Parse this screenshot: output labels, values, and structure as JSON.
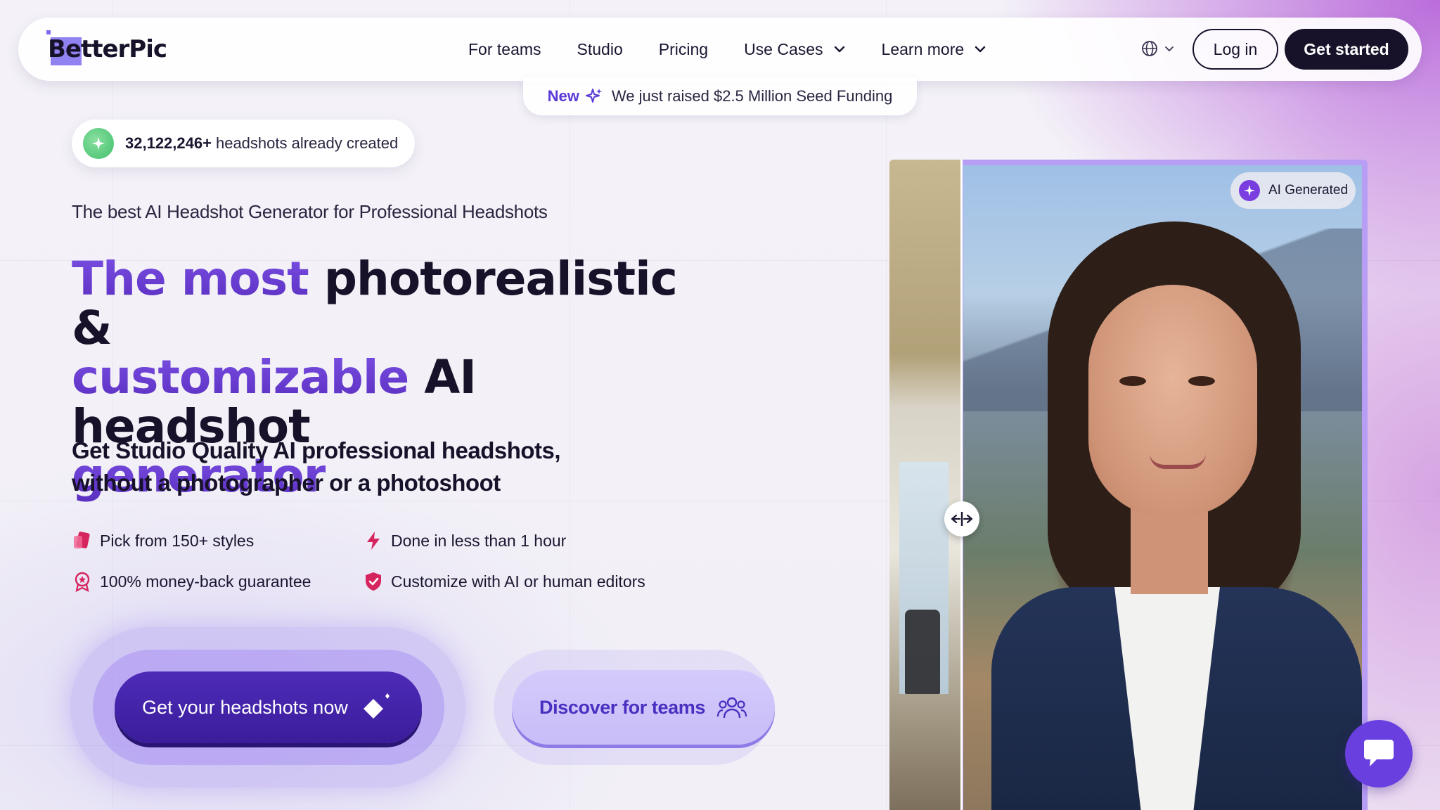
{
  "nav": {
    "logo_text": "BetterPic",
    "links": [
      "For teams",
      "Studio",
      "Pricing",
      "Use Cases",
      "Learn more"
    ],
    "login_label": "Log in",
    "get_started_label": "Get started",
    "language_icon": "globe-icon"
  },
  "announcement": {
    "tag": "New",
    "message": "We just raised $2.5 Million Seed Funding"
  },
  "counter": {
    "count": "32,122,246+",
    "text": "headshots already created"
  },
  "hero": {
    "subtitle": "The best AI Headshot Generator for Professional Headshots",
    "headline_accent": "The most",
    "headline_rest_1": "photorealistic &",
    "headline_accent_2": "customizable",
    "headline_rest_2": "AI headshot",
    "headline_accent_3": "generator",
    "lead_line_1": "Get Studio Quality AI professional headshots,",
    "lead_line_2": "without a photographer or a photoshoot"
  },
  "features": [
    {
      "icon": "styles-icon",
      "label": "Pick from 150+ styles"
    },
    {
      "icon": "lightning-icon",
      "label": "Done in less than 1 hour"
    },
    {
      "icon": "award-icon",
      "label": "100% money-back guarantee"
    },
    {
      "icon": "shield-check-icon",
      "label": "Customize with AI or human editors"
    }
  ],
  "cta": {
    "primary_label": "Get your headshots now",
    "secondary_label": "Discover for teams"
  },
  "image": {
    "badge_label": "AI Generated"
  },
  "colors": {
    "brand_purple": "#5a3ad6",
    "dark": "#17122a",
    "accent_pink": "#d6245e"
  }
}
